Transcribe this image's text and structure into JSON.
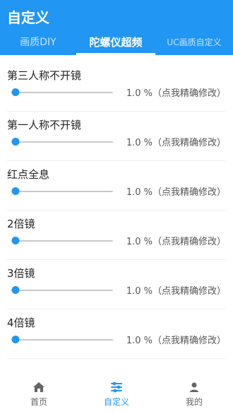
{
  "header": {
    "title": "自定义"
  },
  "tabs": [
    {
      "label": "画质DIY"
    },
    {
      "label": "陀螺仪超频"
    },
    {
      "label": "UC画质自定义"
    }
  ],
  "settings": [
    {
      "label": "第三人称不开镜",
      "value": "1.0 %",
      "hint": "（点我精确修改）",
      "level": 0.01
    },
    {
      "label": "第一人称不开镜",
      "value": "1.0 %",
      "hint": "（点我精确修改）",
      "level": 0.01
    },
    {
      "label": "红点全息",
      "value": "1.0 %",
      "hint": "（点我精确修改）",
      "level": 0.01
    },
    {
      "label": "2倍镜",
      "value": "1.0 %",
      "hint": "（点我精确修改）",
      "level": 0.01
    },
    {
      "label": "3倍镜",
      "value": "1.0 %",
      "hint": "（点我精确修改）",
      "level": 0.01
    },
    {
      "label": "4倍镜",
      "value": "1.0 %",
      "hint": "（点我精确修改）",
      "level": 0.01
    }
  ],
  "bottom_nav": [
    {
      "label": "首页",
      "icon": "home-icon"
    },
    {
      "label": "自定义",
      "icon": "sliders-icon"
    },
    {
      "label": "我的",
      "icon": "user-icon"
    }
  ],
  "colors": {
    "accent": "#2196f3",
    "track": "#c8c8c8",
    "divider": "#eeeeee"
  }
}
